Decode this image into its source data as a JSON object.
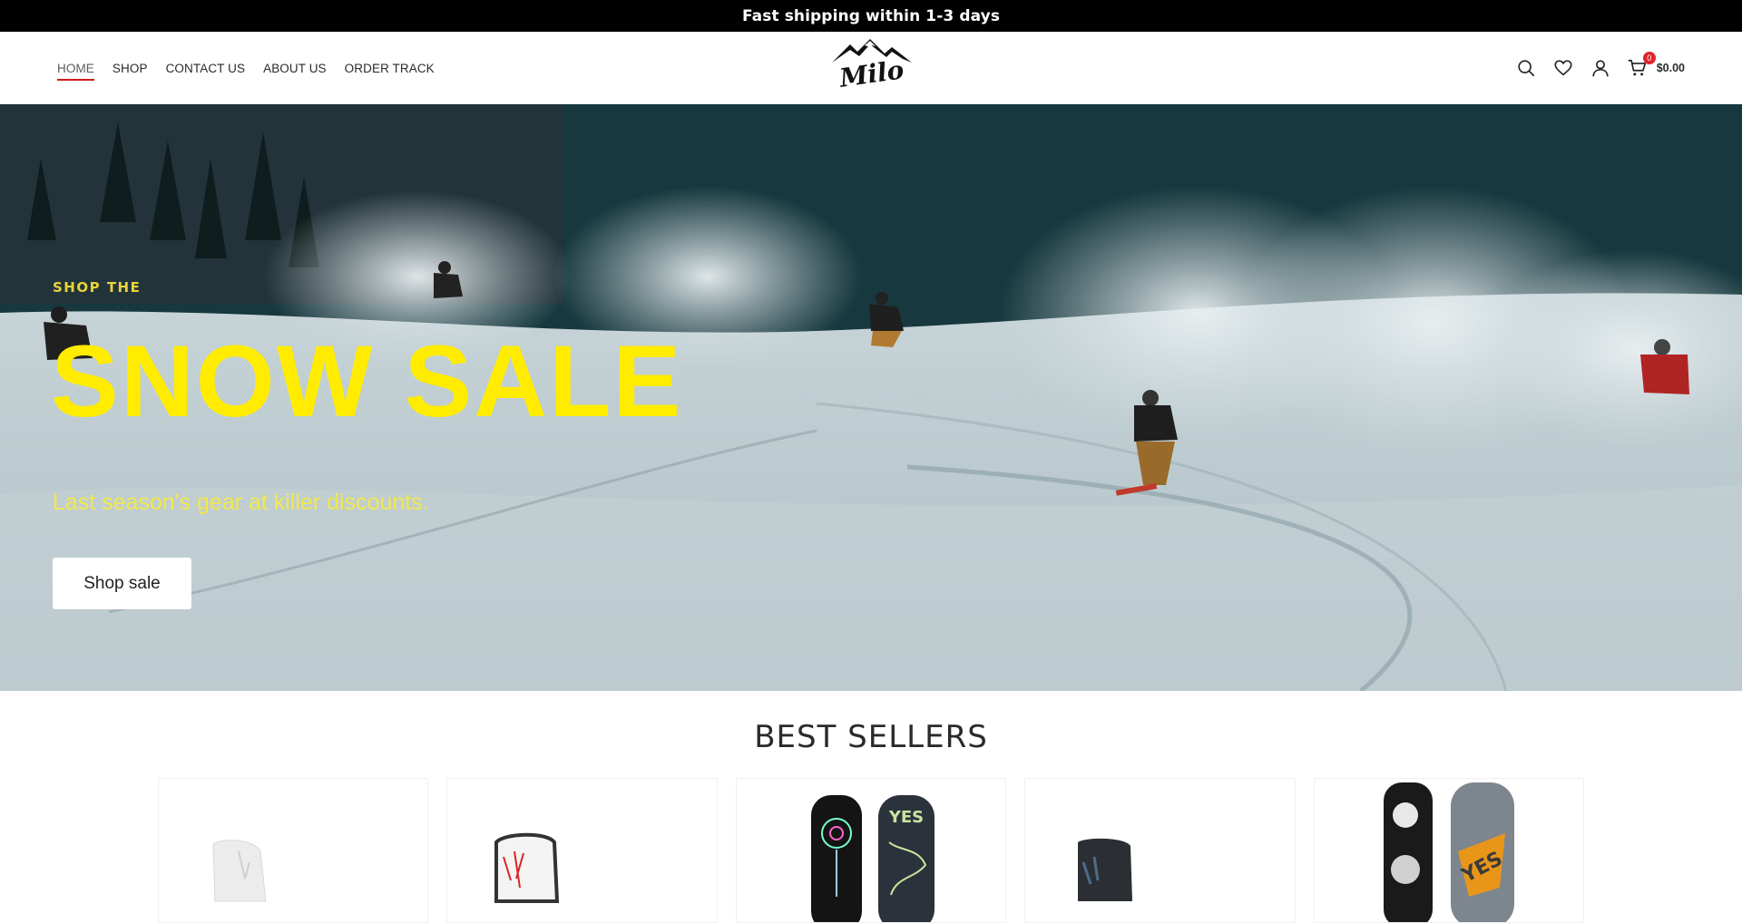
{
  "announcement": {
    "text": "Fast shipping within 1-3 days"
  },
  "nav": {
    "items": [
      {
        "label": "HOME",
        "active": true
      },
      {
        "label": "SHOP",
        "active": false
      },
      {
        "label": "CONTACT US",
        "active": false
      },
      {
        "label": "ABOUT US",
        "active": false
      },
      {
        "label": "ORDER TRACK",
        "active": false
      }
    ]
  },
  "logo": {
    "text": "Milo"
  },
  "tools": {
    "icons": [
      "search-icon",
      "heart-icon",
      "user-icon",
      "cart-icon"
    ],
    "cart_count": "0",
    "cart_total": "$0.00"
  },
  "hero": {
    "eyebrow": "SHOP THE",
    "title": "SNOW SALE",
    "subtitle": "Last season's gear at killer discounts.",
    "button_label": "Shop sale"
  },
  "best_sellers": {
    "title": "BEST SELLERS",
    "products": [
      {
        "name": "white-binding"
      },
      {
        "name": "white-red-binding"
      },
      {
        "name": "yes-snowboard-pair-dark"
      },
      {
        "name": "black-binding"
      },
      {
        "name": "yes-snowboard-pair-orange"
      }
    ]
  },
  "colors": {
    "accent_underline": "#d11c1c",
    "hero_title": "#ffec00",
    "cart_badge": "#e0252b"
  }
}
